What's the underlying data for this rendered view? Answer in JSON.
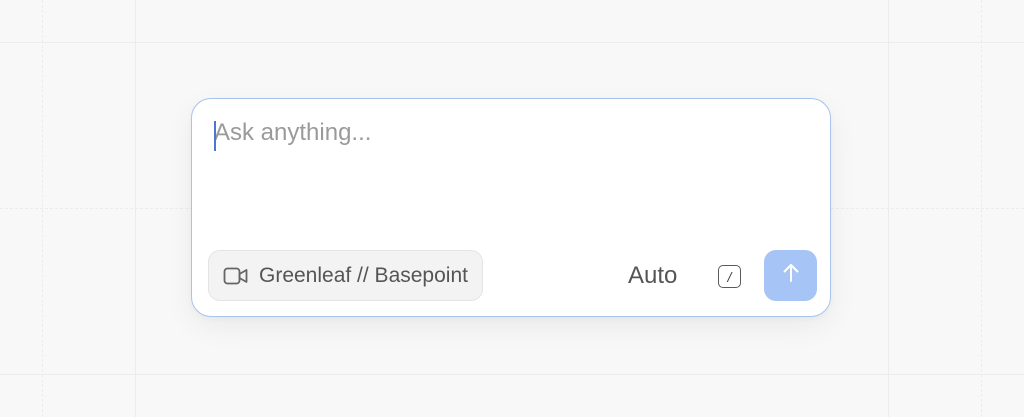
{
  "composer": {
    "placeholder": "Ask anything...",
    "value": ""
  },
  "context_chip": {
    "icon": "video-camera-icon",
    "label": "Greenleaf // Basepoint"
  },
  "mode": {
    "label": "Auto"
  },
  "shortcut": {
    "icon": "slash-command-icon",
    "label": "/"
  },
  "send": {
    "icon": "arrow-up-icon"
  },
  "colors": {
    "background": "#f8f8f8",
    "composer_border": "#a8c4ec",
    "send_button": "#a6c4f5",
    "caret": "#4a78d0",
    "chip_background": "#f3f3f4"
  }
}
